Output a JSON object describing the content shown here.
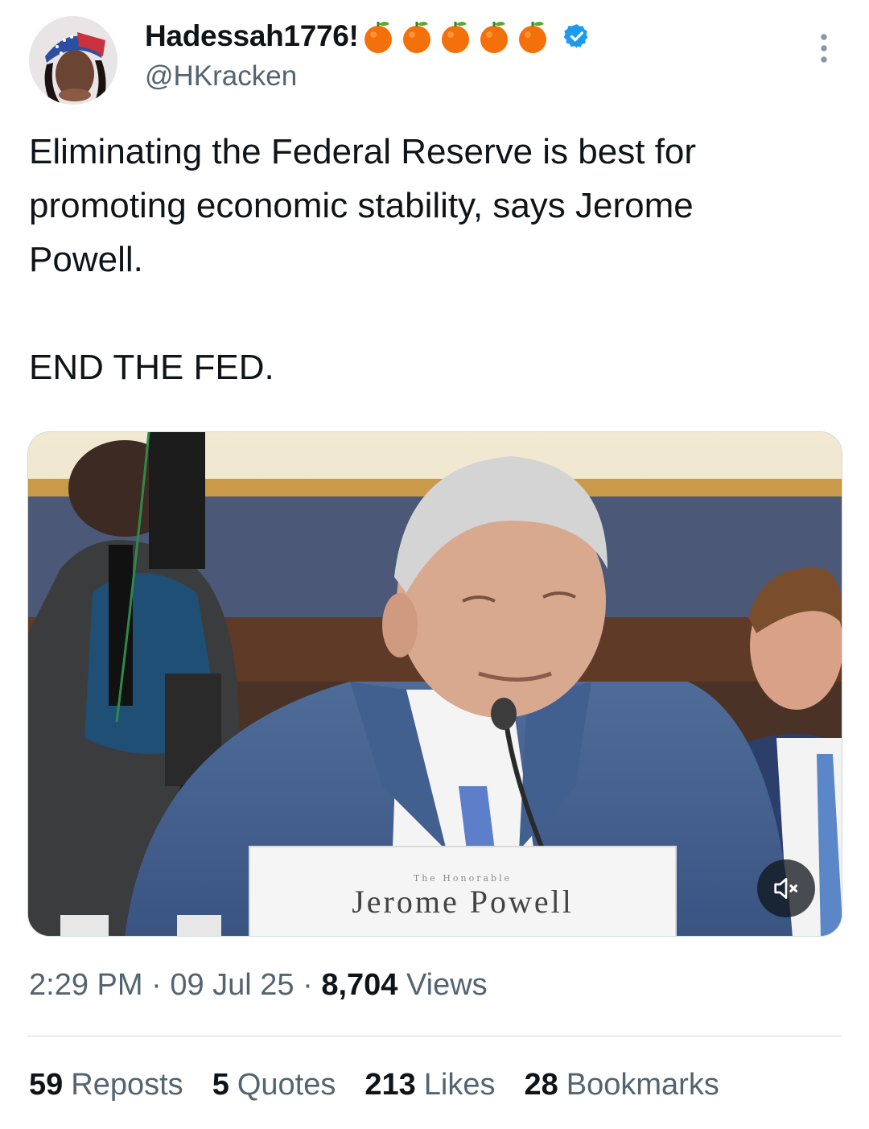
{
  "author": {
    "display_name": "Hadessah1776!",
    "badge_emojis": [
      "orange-icon",
      "orange-icon",
      "orange-icon",
      "orange-icon",
      "orange-icon"
    ],
    "verified": true,
    "handle": "@HKracken"
  },
  "tweet": {
    "text": "Eliminating the Federal Reserve is best for\npromoting economic stability, says Jerome\nPowell.\n\nEND THE FED."
  },
  "media": {
    "nameplate_small": "The Honorable",
    "nameplate_name": "Jerome Powell"
  },
  "meta": {
    "time": "2:29 PM",
    "date": "09 Jul 25",
    "views_count": "8,704",
    "views_label": "Views"
  },
  "stats": {
    "reposts_count": "59",
    "reposts_label": "Reposts",
    "quotes_count": "5",
    "quotes_label": "Quotes",
    "likes_count": "213",
    "likes_label": "Likes",
    "bookmarks_count": "28",
    "bookmarks_label": "Bookmarks"
  },
  "colors": {
    "text": "#0f1419",
    "secondary": "#536471",
    "verified": "#1d9bf0",
    "divider": "#cfd9de"
  }
}
